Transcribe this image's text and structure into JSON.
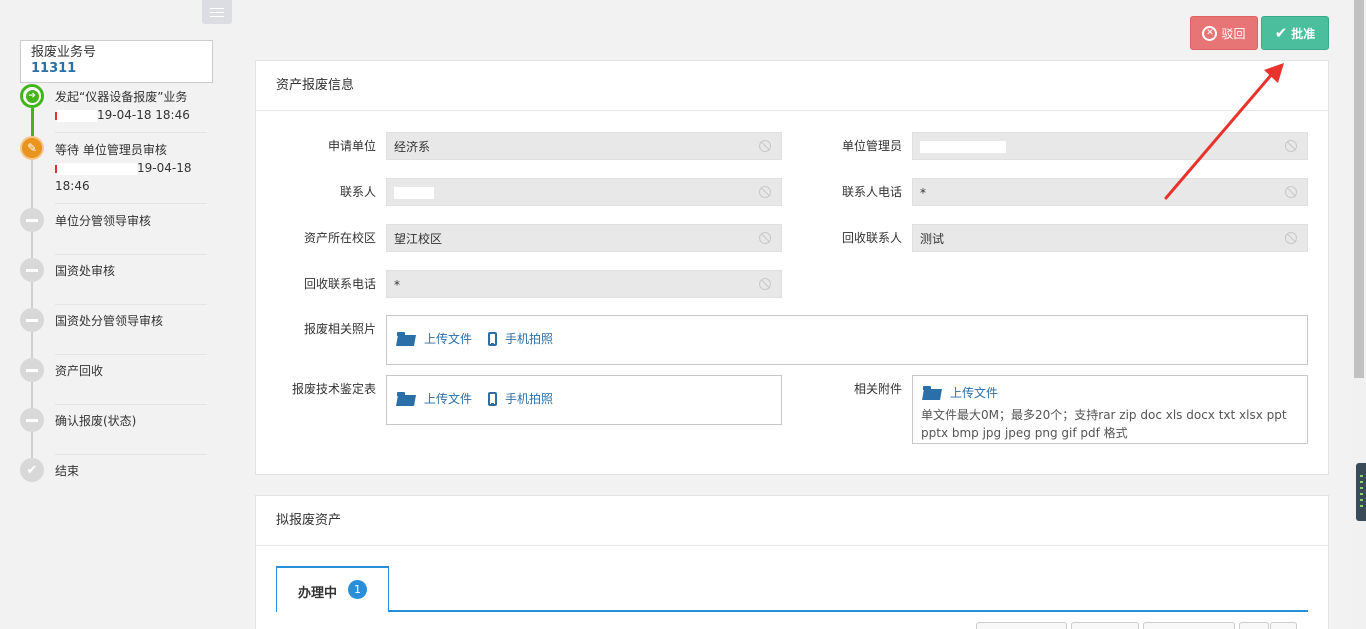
{
  "sidebar": {
    "biz_label": "报废业务号",
    "biz_number": "11311",
    "steps": [
      {
        "line1": "发起“仪器设备报废”业务",
        "line2": "19-04-18 18:46",
        "status": "done"
      },
      {
        "line1": "等待 单位管理员审核",
        "line2": "19-04-18",
        "line3": "18:46",
        "status": "current"
      },
      {
        "label": "单位分管领导审核",
        "status": "pending"
      },
      {
        "label": "国资处审核",
        "status": "pending"
      },
      {
        "label": "国资处分管领导审核",
        "status": "pending"
      },
      {
        "label": "资产回收",
        "status": "pending"
      },
      {
        "label": "确认报废(状态)",
        "status": "pending"
      },
      {
        "label": "结束",
        "status": "end"
      }
    ]
  },
  "toolbar": {
    "reject_label": "驳回",
    "approve_label": "批准"
  },
  "info_panel": {
    "title": "资产报废信息",
    "fields": {
      "apply_unit_label": "申请单位",
      "apply_unit_value": "经济系",
      "unit_admin_label": "单位管理员",
      "contact_label": "联系人",
      "contact_phone_label": "联系人电话",
      "contact_phone_value": "*",
      "campus_label": "资产所在校区",
      "campus_value": "望江校区",
      "recycle_contact_label": "回收联系人",
      "recycle_contact_value": "测试",
      "recycle_phone_label": "回收联系电话",
      "recycle_phone_value": "*",
      "photos_label": "报废相关照片",
      "tech_report_label": "报废技术鉴定表",
      "attachments_label": "相关附件"
    },
    "upload_label": "上传文件",
    "photo_label": "手机拍照",
    "attachment_hint": "单文件最大0M；最多20个；支持rar zip doc xls docx txt xlsx ppt pptx bmp jpg jpeg png gif pdf 格式"
  },
  "assets_panel": {
    "title": "拟报废资产",
    "tab_label": "办理中",
    "tab_badge": "1"
  },
  "colors": {
    "approve": "#4bbf9d",
    "reject": "#e87575",
    "accent": "#2a8fd8",
    "done_step": "#43b51b",
    "current_step": "#e8941f",
    "annotation_arrow": "#e8322b"
  }
}
